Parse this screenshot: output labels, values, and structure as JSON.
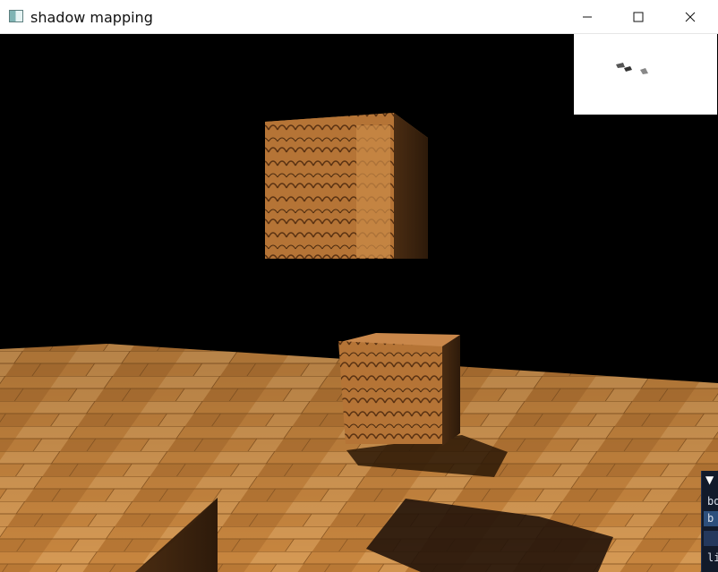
{
  "window": {
    "title": "shadow mapping",
    "controls": {
      "minimize_icon": "minimize-icon",
      "maximize_icon": "maximize-icon",
      "close_icon": "close-icon"
    }
  },
  "imgui": {
    "collapse_arrow": "▼",
    "line1": "bo",
    "line2": "b",
    "line3": "li"
  },
  "colors": {
    "background": "#000000",
    "wood_light": "#c98a47",
    "wood_dark": "#6b3f1c",
    "imgui_bg": "#121a2a",
    "imgui_highlight": "#2d4f7c"
  }
}
